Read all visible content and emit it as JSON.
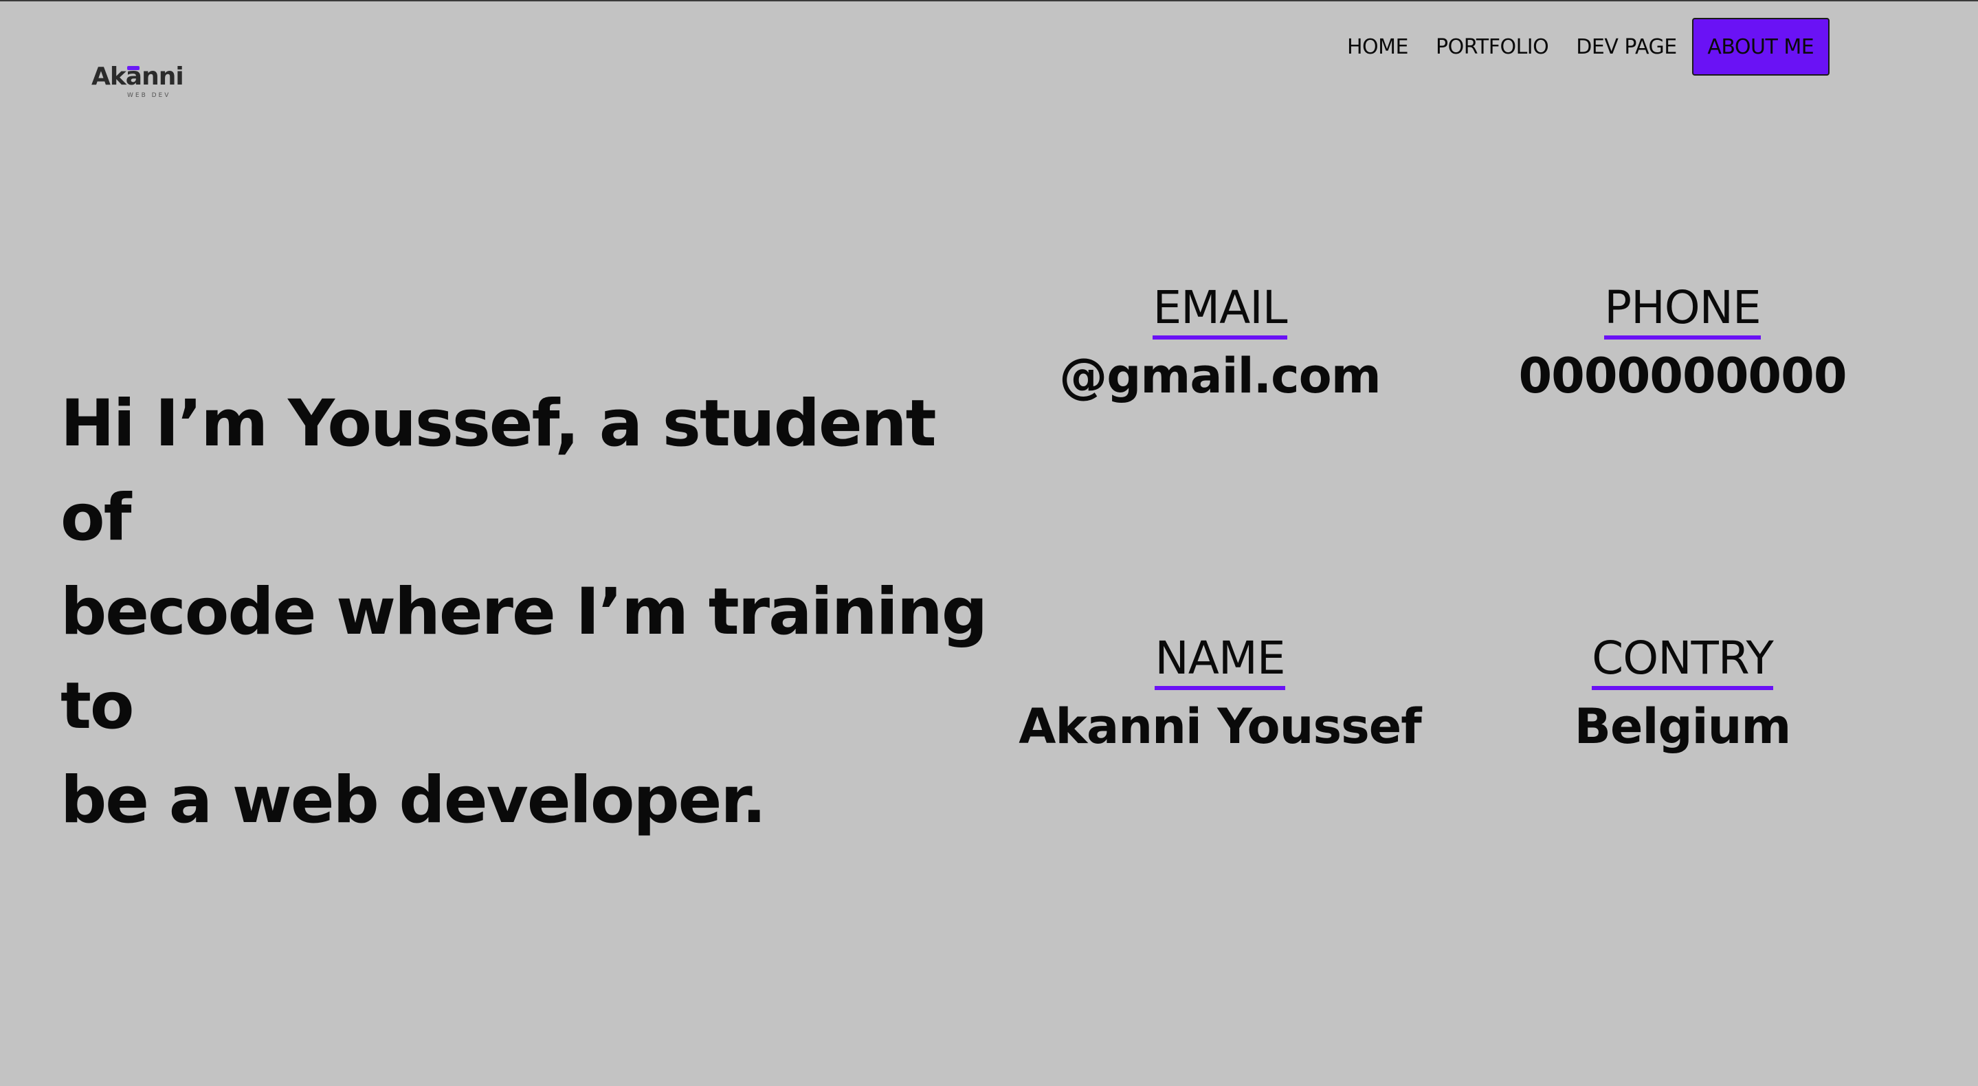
{
  "logo": {
    "text": "Akanni",
    "tagline": "WEB DEV"
  },
  "nav": {
    "items": [
      "HOME",
      "PORTFOLIO",
      "DEV PAGE"
    ],
    "active": "ABOUT ME"
  },
  "hero": {
    "line1": "Hi I’m Youssef, a student of",
    "line2": "becode where I’m training to",
    "line3": "be a web developer."
  },
  "info": {
    "email": {
      "label": "EMAIL",
      "value": "@gmail.com"
    },
    "phone": {
      "label": "PHONE",
      "value": "0000000000"
    },
    "name": {
      "label": "NAME",
      "value": "Akanni Youssef"
    },
    "country": {
      "label": "CONTRY",
      "value": "Belgium"
    }
  },
  "colors": {
    "background": "#c3c3c3",
    "accent": "#6a12f5",
    "text": "#0a0a0a"
  }
}
